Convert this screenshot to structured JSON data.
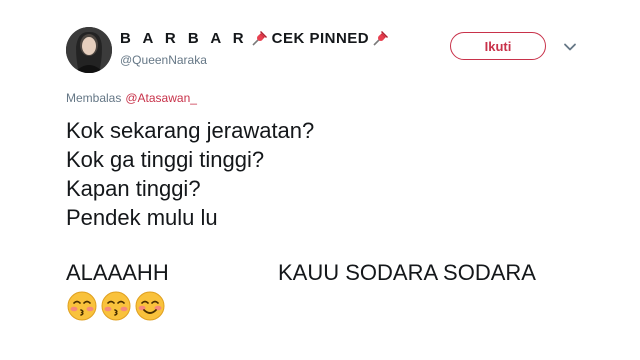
{
  "header": {
    "display_name_part1": "B A R B A R",
    "display_name_part2": "CEK PINNED",
    "handle": "@QueenNaraka",
    "follow_label": "Ikuti",
    "icons": [
      "avatar-photo",
      "pushpin-icon",
      "chevron-down-icon"
    ]
  },
  "reply": {
    "prefix": "Membalas",
    "mention": "@Atasawan_"
  },
  "body": {
    "lines": [
      "Kok sekarang jerawatan?",
      "Kok ga tinggi tinggi?",
      "Kapan tinggi?",
      "Pendek mulu lu"
    ],
    "left_word": "ALAAAHH",
    "right_phrase": "KAUU SODARA SODARA",
    "emojis": [
      "kissing-face-closed-eyes",
      "kissing-face-closed-eyes",
      "smiling-face-blushing"
    ]
  },
  "colors": {
    "accent": "#c8324a",
    "muted": "#657786",
    "text": "#14171a"
  }
}
